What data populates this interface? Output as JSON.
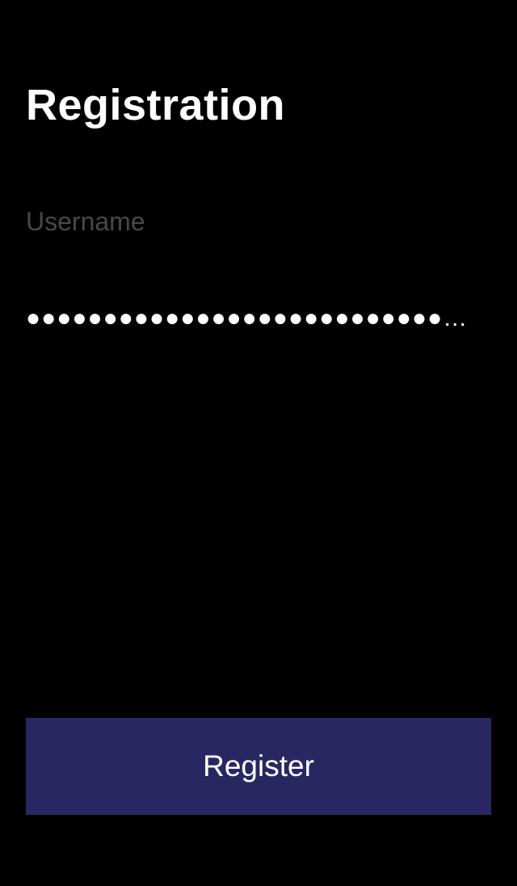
{
  "header": {
    "title": "Registration"
  },
  "form": {
    "username": {
      "placeholder": "Username",
      "value": ""
    },
    "password": {
      "masked_value": "●●●●●●●●●●●●●●●●●●●●●●●●●●●●●●●●●●●●●●"
    },
    "register_label": "Register"
  },
  "colors": {
    "background": "#000000",
    "text": "#ffffff",
    "placeholder": "#48484a",
    "button": "#292762"
  }
}
